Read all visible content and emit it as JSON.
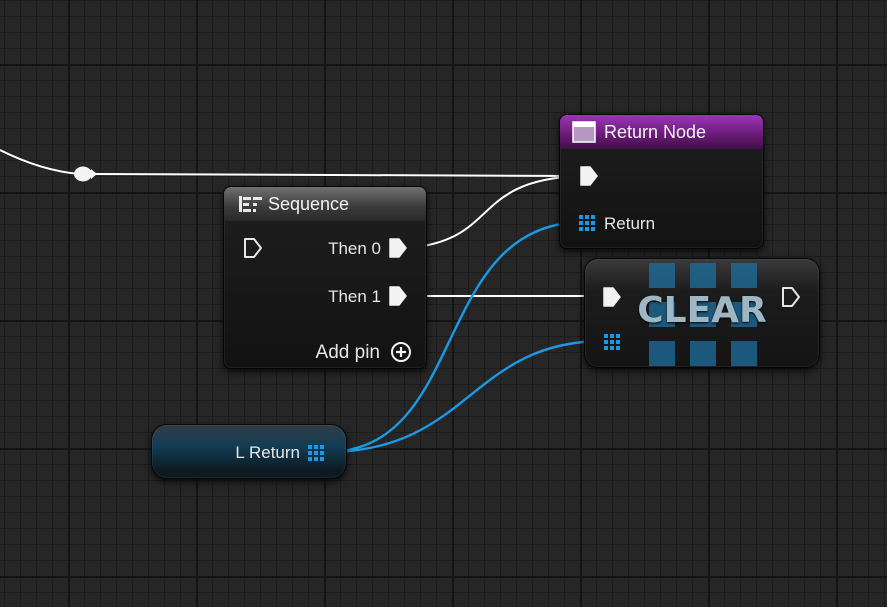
{
  "graph": {
    "colors": {
      "background": "#262626",
      "exec_wire": "#ffffff",
      "data_wire": "#1a9ae6",
      "function_header": "#9c36b8",
      "macro_header": "#707070"
    }
  },
  "reroute": {
    "icon": "reroute-knot"
  },
  "sequence_node": {
    "title": "Sequence",
    "icon": "sequence-icon",
    "outputs": [
      "Then 0",
      "Then 1"
    ],
    "add_pin_label": "Add pin"
  },
  "return_node": {
    "title": "Return Node",
    "icon": "function-icon",
    "return_label": "Return"
  },
  "clear_node": {
    "title": "CLEAR",
    "icon": "array-grid-icon"
  },
  "l_return_node": {
    "label": "L Return",
    "icon": "array-grid-icon"
  }
}
